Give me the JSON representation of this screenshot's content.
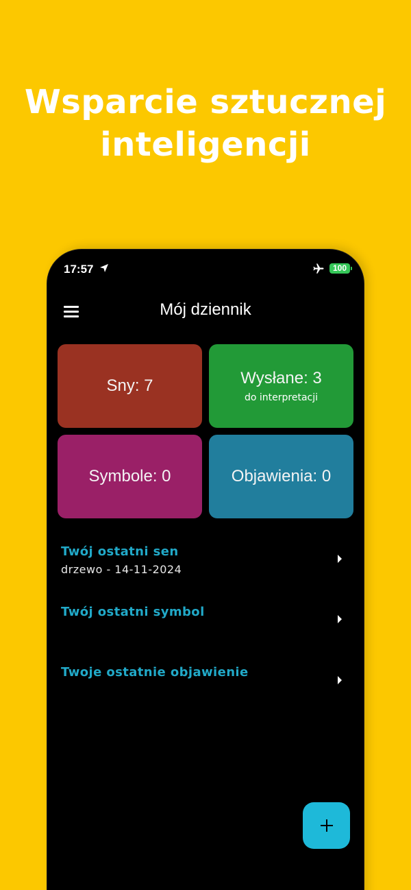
{
  "headline": {
    "line1": "Wsparcie sztucznej",
    "line2": "inteligencji"
  },
  "status_bar": {
    "time": "17:57",
    "battery": "100",
    "icons": [
      "location-arrow-icon",
      "airplane-icon",
      "battery-icon"
    ]
  },
  "app": {
    "title": "Mój dziennik",
    "menu_icon": "hamburger-menu-icon"
  },
  "tiles": {
    "dreams": {
      "label": "Sny: 7",
      "color": "#9A3222"
    },
    "sent": {
      "label": "Wysłane: 3",
      "sublabel": "do interpretacji",
      "color": "#229A37"
    },
    "symbols": {
      "label": "Symbole: 0",
      "color": "#9A2067"
    },
    "revelations": {
      "label": "Objawienia: 0",
      "color": "#217E9D"
    }
  },
  "recent": {
    "last_dream": {
      "title": "Twój ostatni sen",
      "detail": "drzewo - 14-11-2024"
    },
    "last_symbol": {
      "title": "Twój ostatni symbol"
    },
    "last_revelation": {
      "title": "Twoje ostatnie objawienie"
    }
  },
  "fab": {
    "icon": "plus-icon"
  },
  "colors": {
    "background": "#FCC800",
    "accent": "#21A9C8",
    "fab": "#1EB9D9"
  }
}
